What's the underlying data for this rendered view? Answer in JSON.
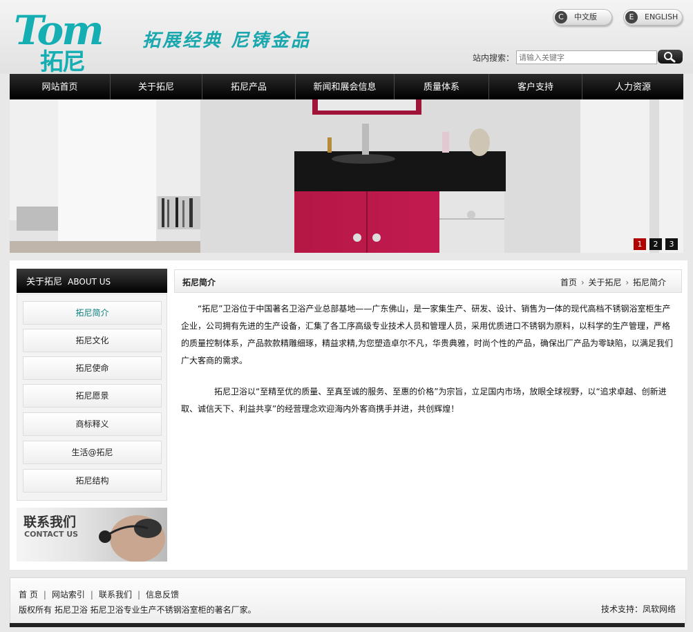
{
  "header": {
    "logo_mark": "Tom",
    "logo_cn": "拓尼",
    "slogan": "拓展经典  尼铸金品",
    "lang_cn": {
      "badge": "C",
      "label": "中文版"
    },
    "lang_en": {
      "badge": "E",
      "label": "ENGLISH"
    },
    "search_label": "站内搜索：",
    "search_placeholder": "请输入关键字"
  },
  "nav": [
    "网站首页",
    "关于拓尼",
    "拓尼产品",
    "新闻和展会信息",
    "质量体系",
    "客户支持",
    "人力资源"
  ],
  "banner": {
    "dots": [
      "1",
      "2",
      "3"
    ],
    "active_dot": 0
  },
  "sidebar": {
    "title_cn": "关于拓尼",
    "title_en": "ABOUT US",
    "items": [
      "拓尼简介",
      "拓尼文化",
      "拓尼使命",
      "拓尼愿景",
      "商标释义",
      "生活@拓尼",
      "拓尼结构"
    ],
    "active_index": 0,
    "contact_cn": "联系我们",
    "contact_en": "CONTACT US"
  },
  "main": {
    "title": "拓尼简介",
    "breadcrumb": [
      "首页",
      "关于拓尼",
      "拓尼简介"
    ],
    "paragraphs": [
      "“拓尼”卫浴位于中国著名卫浴产业总部基地——广东佛山，是一家集生产、研发、设计、销售为一体的现代高档不锈钢浴室柜生产企业，公司拥有先进的生产设备，汇集了各工序高级专业技术人员和管理人员，采用优质进口不锈钢为原料，以科学的生产管理，严格的质量控制体系，产品款款精雕细琢，精益求精,为您塑造卓尔不凡，华贵典雅，时尚个性的产品，确保出厂产品为零缺陷，以满足我们广大客商的需求。",
      "拓尼卫浴以“至精至优的质量、至真至诚的服务、至惠的价格”为宗旨，立足国内市场，放眼全球视野，以“追求卓越、创新进取、诚信天下、利益共享”的经营理念欢迎海内外客商携手并进，共创辉煌！"
    ]
  },
  "footer": {
    "links": [
      "首 页",
      "网站索引",
      "联系我们",
      "信息反馈"
    ],
    "copyright": "版权所有 拓尼卫浴 拓尼卫浴专业生产不锈钢浴室柜的著名厂家。",
    "support": "技术支持：凤软网络"
  }
}
